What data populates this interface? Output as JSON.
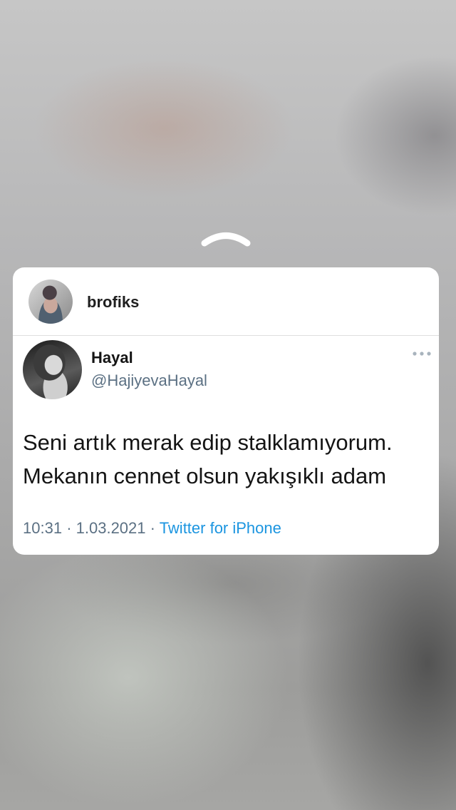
{
  "share_card": {
    "sharer": {
      "name": "brofiks",
      "avatar": "profile-photo"
    }
  },
  "tweet": {
    "author": {
      "name": "Hayal",
      "handle": "@HajiyevaHayal",
      "avatar": "profile-photo"
    },
    "text_lines": [
      "Seni artık merak edip stalklamıyorum.",
      "Mekanın cennet olsun yakışıklı adam"
    ],
    "time": "10:31",
    "separator": "·",
    "date": "1.03.2021",
    "source": "Twitter for iPhone",
    "more_icon": "more-dots-icon"
  },
  "swipe_indicator_icon": "chevron-up-icon",
  "colors": {
    "card_background": "#ffffff",
    "secondary_text": "#5b7083",
    "source_link": "#1b95e0",
    "primary_text": "#141414"
  }
}
